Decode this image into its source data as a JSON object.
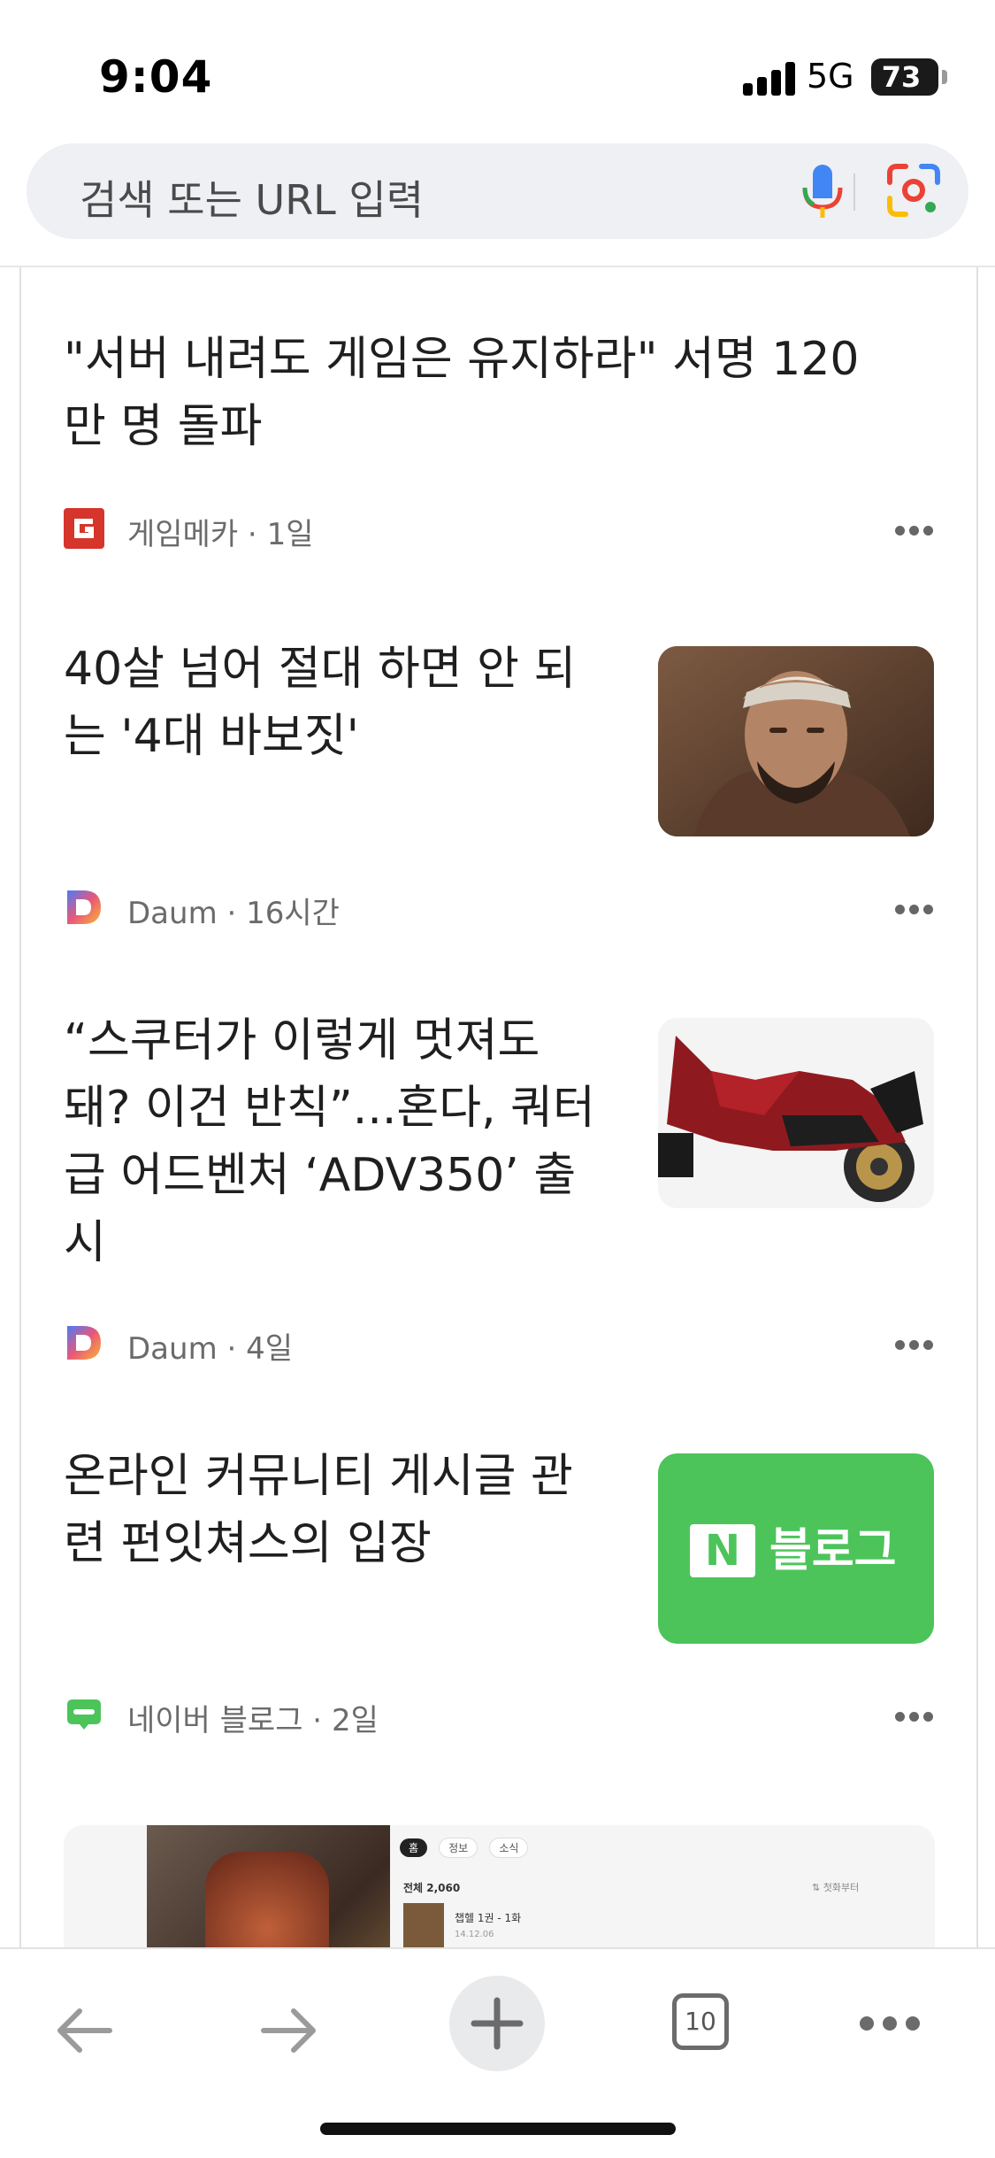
{
  "status_bar": {
    "time": "9:04",
    "network": "5G",
    "battery": "73"
  },
  "search": {
    "placeholder": "검색 또는 URL 입력",
    "mic_icon": "mic-icon",
    "lens_icon": "google-lens-icon"
  },
  "feed": {
    "items": [
      {
        "title_lines": [
          "\"서버 내려도 게임은 유지하라\" 서명 120",
          "만 명 돌파"
        ],
        "source": "게임메카",
        "age": "1일",
        "source_icon": "gamemeca-logo-icon"
      },
      {
        "title_lines": [
          "40살 넘어 절대 하면 안 되",
          "는 '4대 바보짓'"
        ],
        "source": "Daum",
        "age": "16시간",
        "source_icon": "daum-logo-icon"
      },
      {
        "title_lines": [
          "“스쿠터가 이렇게 멋져도",
          "돼? 이건 반칙”...혼다, 쿼터",
          "급 어드벤처 ‘ADV350’ 출",
          "시"
        ],
        "source": "Daum",
        "age": "4일",
        "source_icon": "daum-logo-icon"
      },
      {
        "title_lines": [
          "온라인 커뮤니티 게시글 관",
          "련 펀잇쳐스의 입장"
        ],
        "source": "네이버 블로그",
        "age": "2일",
        "source_icon": "naver-blog-icon",
        "thumb_label": "블로그",
        "thumb_letter": "N"
      }
    ],
    "partial_card": {
      "tabs": [
        "홈",
        "정보",
        "소식"
      ],
      "count": "전체 2,060",
      "sort": "⇅ 첫화부터",
      "episode": "챕헬 1권 - 1화",
      "date": "14.12.06"
    }
  },
  "toolbar": {
    "tab_count": "10"
  },
  "colors": {
    "search_bg": "#eef0f3",
    "naver_green": "#4cc45a",
    "gamemeca_red": "#d6352b"
  }
}
